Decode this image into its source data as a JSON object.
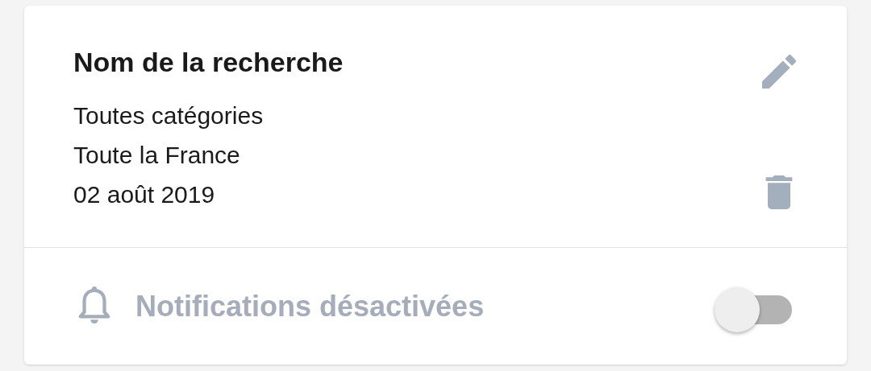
{
  "search": {
    "title": "Nom de la recherche",
    "details": [
      "Toutes catégories",
      "Toute la France",
      "02 août 2019"
    ]
  },
  "notifications": {
    "label": "Notifications désactivées",
    "on": false
  }
}
